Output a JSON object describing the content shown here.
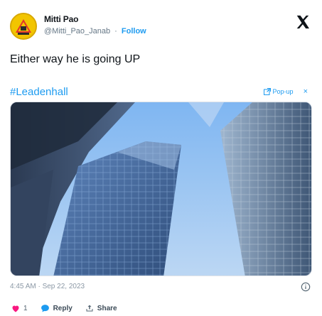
{
  "author": {
    "display_name": "Mitti Pao",
    "handle": "@Mitti_Pao_Janab",
    "separator": "·",
    "follow_label": "Follow"
  },
  "tweet": {
    "text": "Either way he is going UP",
    "hashtag": "#Leadenhall",
    "popup_label": "Pop-up",
    "popup_close": "×",
    "timestamp": "4:45 AM · Sep 22, 2023"
  },
  "actions": {
    "like_count": "1",
    "reply_label": "Reply",
    "share_label": "Share"
  },
  "colors": {
    "accent": "#1d9bf0",
    "like": "#f91880",
    "avatar_bg": "#f2c500"
  },
  "icons": {
    "close": "x-logo-icon",
    "like": "heart-icon",
    "reply": "reply-bubble-icon",
    "share": "share-icon",
    "info": "info-icon",
    "popup": "popup-icon"
  }
}
